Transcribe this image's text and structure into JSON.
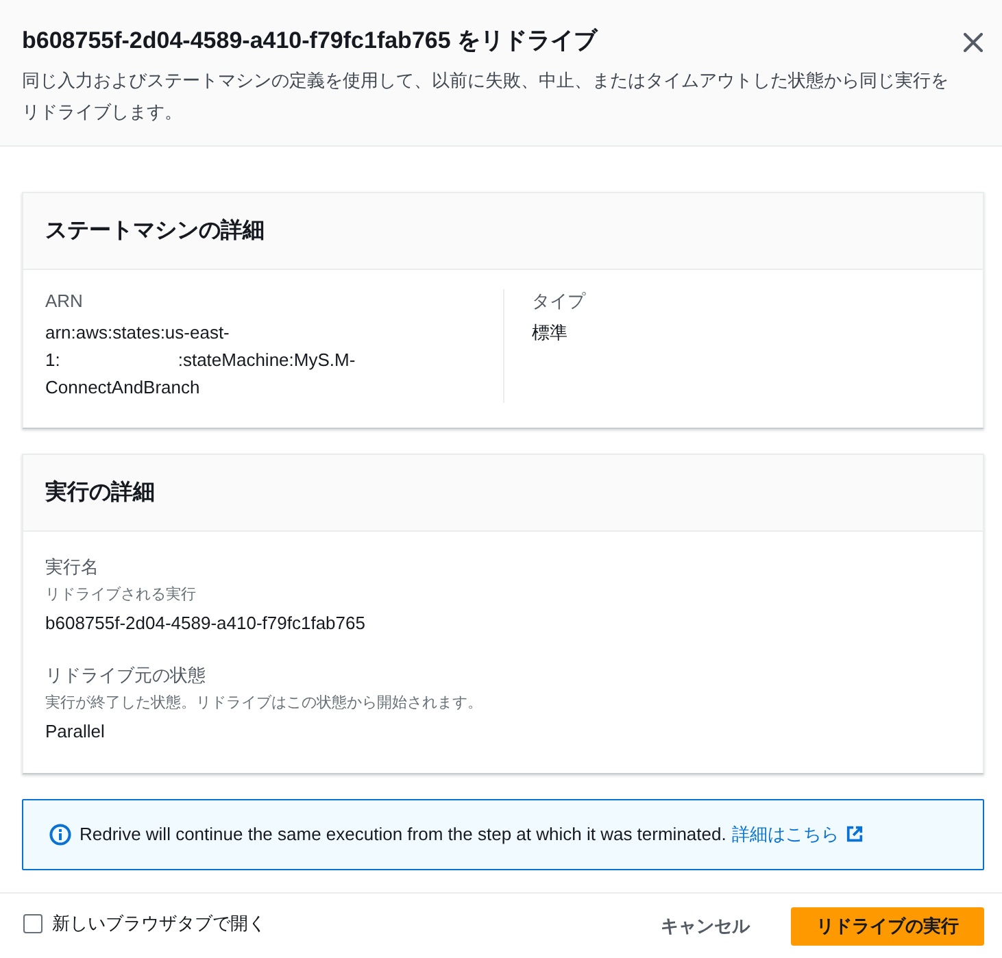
{
  "dialog": {
    "title": "b608755f-2d04-4589-a410-f79fc1fab765 をリドライブ",
    "description": "同じ入力およびステートマシンの定義を使用して、以前に失敗、中止、またはタイムアウトした状態から同じ実行をリドライブします。"
  },
  "sections": [
    {
      "title": "ステートマシンの詳細",
      "kind": "columns",
      "fields": [
        {
          "label": "ARN",
          "value_parts": [
            "arn:aws:states:us-east-1:",
            ":stateMachine:MyS.M-ConnectAndBranch"
          ]
        },
        {
          "label": "タイプ",
          "value": "標準"
        }
      ]
    },
    {
      "title": "実行の詳細",
      "kind": "stacked",
      "fields": [
        {
          "label": "実行名",
          "description": "リドライブされる実行",
          "value": "b608755f-2d04-4589-a410-f79fc1fab765"
        },
        {
          "label": "リドライブ元の状態",
          "description": "実行が終了した状態。リドライブはこの状態から開始されます。",
          "value": "Parallel"
        }
      ]
    }
  ],
  "alert": {
    "kind": "info",
    "text": "Redrive will continue the same execution from the step at which it was terminated.",
    "link": "詳細はこちら"
  },
  "footer": {
    "checkbox": {
      "label": "新しいブラウザタブで開く",
      "checked": false
    },
    "buttons": [
      {
        "label": "キャンセル",
        "kind": "link"
      },
      {
        "label": "リドライブの実行",
        "kind": "primary"
      }
    ]
  }
}
